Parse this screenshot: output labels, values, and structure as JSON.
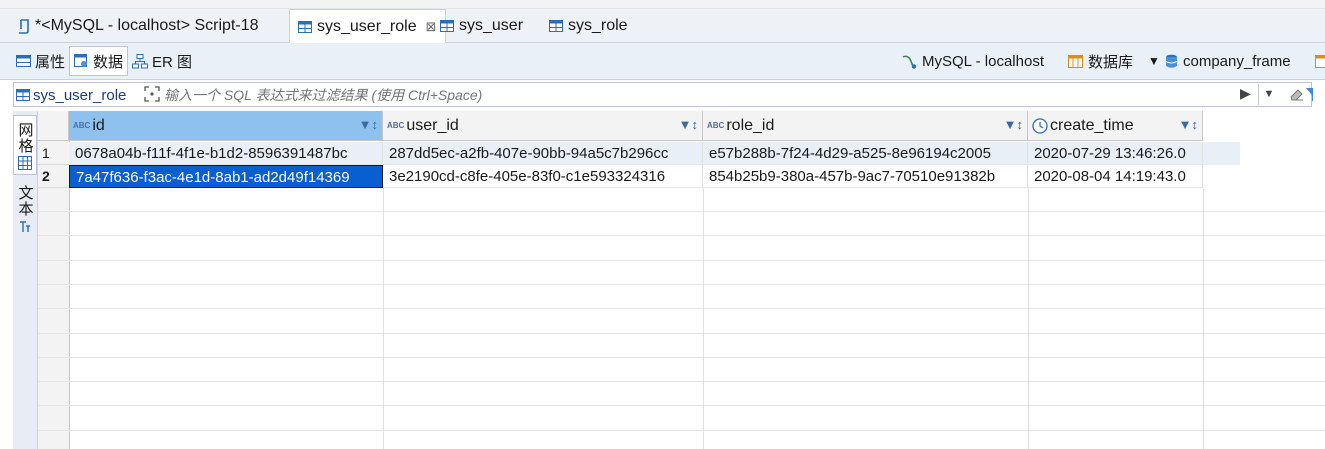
{
  "editor_tabs": [
    {
      "label": "*<MySQL - localhost> Script-18",
      "active": false
    },
    {
      "label": "sys_user_role",
      "active": true
    },
    {
      "label": "sys_user",
      "active": false
    },
    {
      "label": "sys_role",
      "active": false
    }
  ],
  "close_glyph": "⊠",
  "subtabs": [
    {
      "label": "属性",
      "active": false
    },
    {
      "label": "数据",
      "active": true
    },
    {
      "label": "ER 图",
      "active": false
    }
  ],
  "toolbar_right": {
    "connection": "MySQL - localhost",
    "database_label": "数据库",
    "schema": "company_frame"
  },
  "filter": {
    "table": "sys_user_role",
    "placeholder": "输入一个 SQL 表达式来过滤结果 (使用 Ctrl+Space)"
  },
  "side_panel": {
    "grid_label": "网格",
    "text_label": "文本"
  },
  "grid": {
    "columns": [
      {
        "name": "id",
        "type_badge": "ABC"
      },
      {
        "name": "user_id",
        "type_badge": "ABC"
      },
      {
        "name": "role_id",
        "type_badge": "ABC"
      },
      {
        "name": "create_time",
        "type_badge": "clock"
      }
    ],
    "rows": [
      {
        "num": "1",
        "id": "0678a04b-f11f-4f1e-b1d2-8596391487bc",
        "user_id": "287dd5ec-a2fb-407e-90bb-94a5c7b296cc",
        "role_id": "e57b288b-7f24-4d29-a525-8e96194c2005",
        "create_time": "2020-07-29 13:46:26.0"
      },
      {
        "num": "2",
        "id": "7a47f636-f3ac-4e1d-8ab1-ad2d49f14369",
        "user_id": "3e2190cd-c8fe-405e-83f0-c1e593324316",
        "role_id": "854b25b9-380a-457b-9ac7-70510e91382b",
        "create_time": "2020-08-04 14:19:43.0"
      }
    ],
    "selected_cell": {
      "row": 2,
      "column": "id"
    }
  },
  "colors": {
    "accent": "#0a5fd0",
    "header_selected": "#8fc1ef",
    "toolbar_bg": "#eaf0f8"
  }
}
